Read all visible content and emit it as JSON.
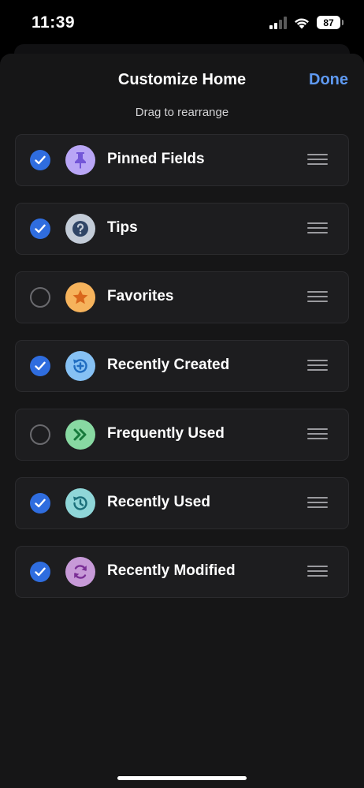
{
  "status_bar": {
    "time": "11:39",
    "battery": "87"
  },
  "sheet": {
    "title": "Customize Home",
    "done_label": "Done",
    "subtitle": "Drag to rearrange"
  },
  "colors": {
    "accent": "#5f9af2",
    "checkbox_on": "#2f6ddf",
    "background": "#161617",
    "row": "#1d1d1f"
  },
  "items": [
    {
      "label": "Pinned Fields",
      "checked": true,
      "icon": "pin-icon",
      "icon_bg": "#b9a6f6",
      "icon_fg": "#7356d8"
    },
    {
      "label": "Tips",
      "checked": true,
      "icon": "question-icon",
      "icon_bg": "#c3ccd8",
      "icon_fg": "#2f4566"
    },
    {
      "label": "Favorites",
      "checked": false,
      "icon": "star-icon",
      "icon_bg": "#f6b35c",
      "icon_fg": "#d9671c"
    },
    {
      "label": "Recently Created",
      "checked": true,
      "icon": "history-plus-icon",
      "icon_bg": "#86c1f4",
      "icon_fg": "#1f6cc0"
    },
    {
      "label": "Frequently Used",
      "checked": false,
      "icon": "double-chevron-icon",
      "icon_bg": "#88d9a2",
      "icon_fg": "#187a3c"
    },
    {
      "label": "Recently Used",
      "checked": true,
      "icon": "history-icon",
      "icon_bg": "#8fd6d8",
      "icon_fg": "#1b6f7a"
    },
    {
      "label": "Recently Modified",
      "checked": true,
      "icon": "refresh-icon",
      "icon_bg": "#c79ad8",
      "icon_fg": "#7a2f96"
    }
  ]
}
